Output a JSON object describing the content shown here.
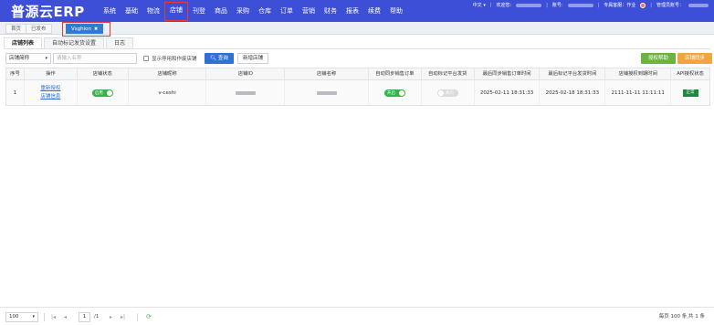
{
  "app": {
    "logo": "普源云ERP"
  },
  "nav": [
    "系统",
    "基础",
    "物流",
    "店铺",
    "刊登",
    "商品",
    "采购",
    "仓库",
    "订单",
    "营销",
    "财务",
    "报表",
    "续费",
    "帮助"
  ],
  "topright": {
    "lang": "中文 ▾",
    "welcome": "欢迎您:",
    "account": "账号:",
    "exclusive": "专属客服：作业",
    "admin": "管理员账号："
  },
  "page_tabs": [
    {
      "label": "首页"
    },
    {
      "label": "已发布"
    },
    {
      "label": "Vsghion",
      "close": "✖"
    }
  ],
  "sub_tabs": [
    "店铺列表",
    "自动标记发货设置",
    "日志"
  ],
  "toolbar": {
    "select_value": "店铺简称",
    "input_placeholder": "请输入名称",
    "checkbox_label": "显示停用和作废店铺",
    "search_label": "查询",
    "add_label": "新增店铺",
    "auth_label": "授权帮助",
    "sync_label": "店铺同步"
  },
  "table": {
    "columns": [
      "序号",
      "操作",
      "店铺状态",
      "店铺昵称",
      "店铺ID",
      "店铺名称",
      "自动同步销售订单",
      "自动标记平台发货",
      "最后同步销售订单时间",
      "最后标记平台发货时间",
      "店铺授权到期时间",
      "API授权状态"
    ],
    "rows": [
      {
        "index": "1",
        "op1": "重新授权",
        "op2": "店铺信息",
        "status": "启用",
        "nickname": "v-ceshi",
        "auto_sync": "开启",
        "auto_mark": "关闭",
        "last_sync": "2025-02-11 18:31:33",
        "last_mark": "2025-02-18 18:31:33",
        "expire": "2111-11-11 11:11:11",
        "api_status": "正常"
      }
    ]
  },
  "pager": {
    "size": "100",
    "page": "1",
    "total": "/1",
    "info": "每页 100 条,共 1 条"
  }
}
